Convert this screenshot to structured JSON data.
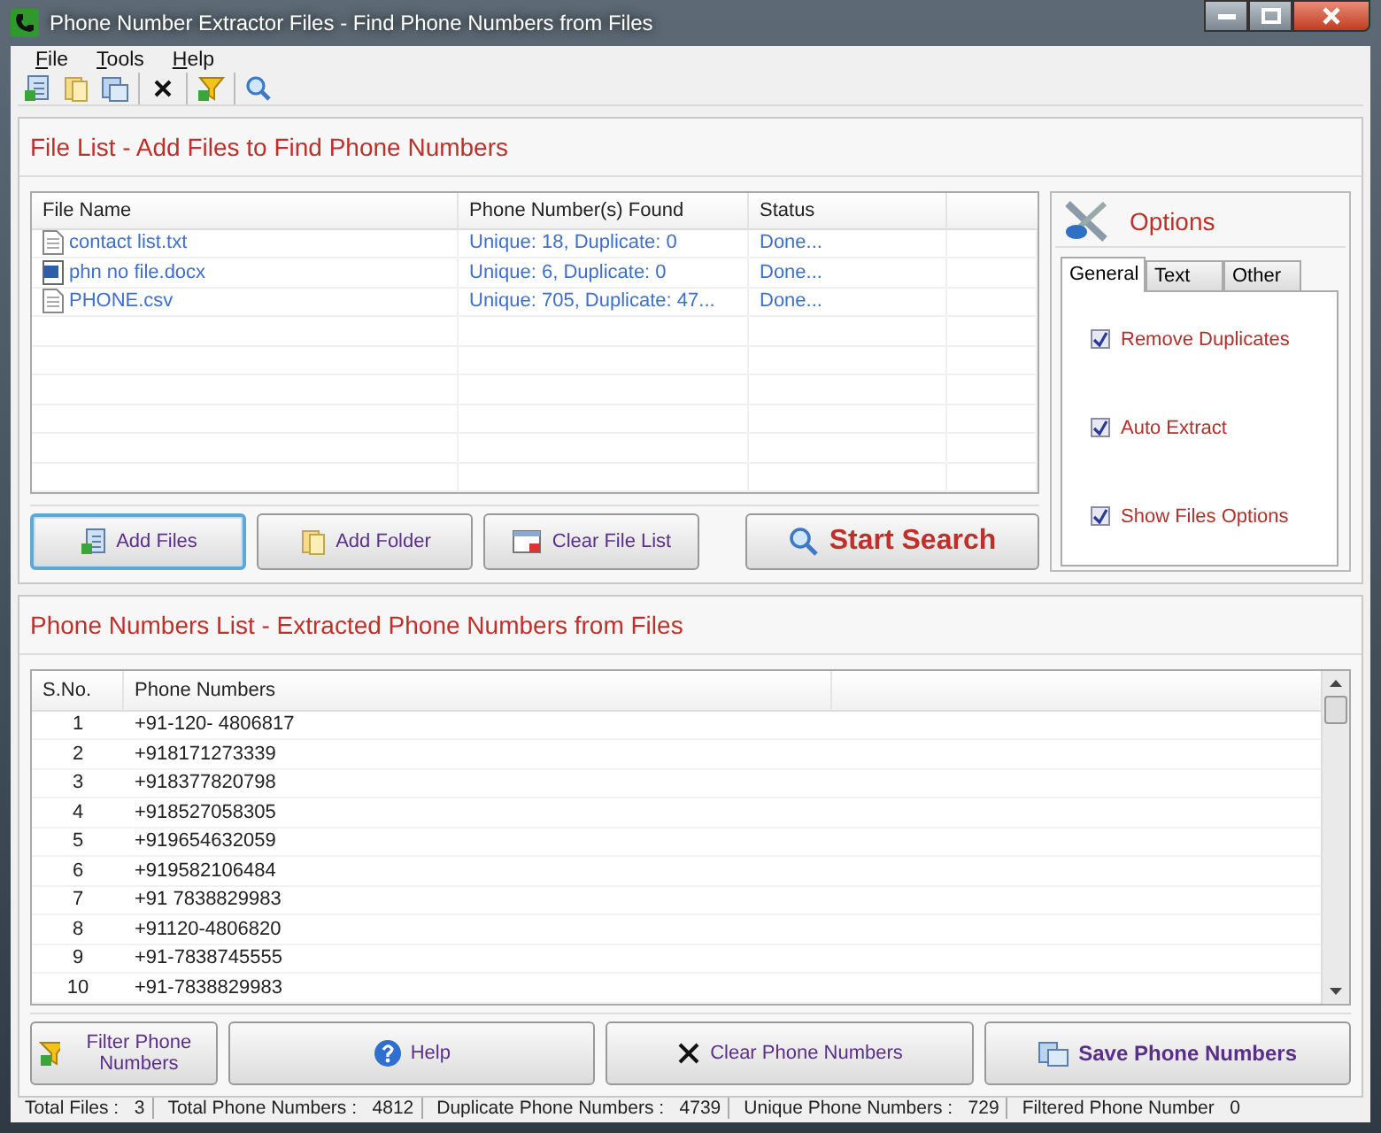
{
  "window": {
    "title": "Phone Number Extractor Files - Find Phone Numbers from Files"
  },
  "menu": [
    {
      "label": "File"
    },
    {
      "label": "Tools"
    },
    {
      "label": "Help"
    }
  ],
  "file_list": {
    "heading": "File List - Add Files to Find Phone Numbers",
    "columns": [
      "File Name",
      "Phone Number(s) Found",
      "Status"
    ],
    "rows": [
      {
        "kind": "text",
        "name": "contact list.txt",
        "found": "Unique: 18, Duplicate: 0",
        "status": "Done..."
      },
      {
        "kind": "document",
        "name": "phn no file.docx",
        "found": "Unique: 6, Duplicate: 0",
        "status": "Done..."
      },
      {
        "kind": "text",
        "name": "PHONE.csv",
        "found": "Unique: 705, Duplicate: 47...",
        "status": "Done..."
      }
    ],
    "buttons": [
      {
        "kind": "normal",
        "label": "Add Files",
        "focused": true
      },
      {
        "kind": "normal",
        "label": "Add Folder",
        "focused": false
      },
      {
        "kind": "normal",
        "label": "Clear File List",
        "focused": false
      },
      {
        "kind": "primary",
        "label": "Start Search",
        "focused": false
      }
    ]
  },
  "options": {
    "title": "Options",
    "tabs": [
      {
        "label": "General",
        "selected": true
      },
      {
        "label": "Text",
        "selected": false
      },
      {
        "label": "Other",
        "selected": false
      }
    ],
    "checks": [
      {
        "label": "Remove Duplicates",
        "checked": true
      },
      {
        "label": "Auto Extract",
        "checked": true
      },
      {
        "label": "Show Files Options",
        "checked": true
      }
    ]
  },
  "phone_list": {
    "heading": "Phone Numbers List - Extracted Phone Numbers from Files",
    "columns": [
      "S.No.",
      "Phone Numbers"
    ],
    "rows": [
      {
        "sno": "1",
        "number": "+91-120- 4806817"
      },
      {
        "sno": "2",
        "number": "+918171273339"
      },
      {
        "sno": "3",
        "number": "+918377820798"
      },
      {
        "sno": "4",
        "number": "+918527058305"
      },
      {
        "sno": "5",
        "number": "+919654632059"
      },
      {
        "sno": "6",
        "number": "+919582106484"
      },
      {
        "sno": "7",
        "number": "+91 7838829983"
      },
      {
        "sno": "8",
        "number": "+91120-4806820"
      },
      {
        "sno": "9",
        "number": "+91-7838745555"
      },
      {
        "sno": "10",
        "number": "+91-7838829983"
      }
    ],
    "buttons": [
      {
        "kind": "normal",
        "label": "Filter Phone Numbers"
      },
      {
        "kind": "normal",
        "label": "Help"
      },
      {
        "kind": "normal",
        "label": "Clear Phone Numbers"
      },
      {
        "kind": "bold",
        "label": "Save Phone Numbers"
      }
    ]
  },
  "status_bar": [
    {
      "label": "Total Files :",
      "value": "3"
    },
    {
      "label": "Total Phone Numbers :",
      "value": "4812"
    },
    {
      "label": "Duplicate Phone Numbers :",
      "value": "4739"
    },
    {
      "label": "Unique Phone Numbers :",
      "value": "729"
    },
    {
      "label": "Filtered Phone Number",
      "value": "0"
    }
  ]
}
